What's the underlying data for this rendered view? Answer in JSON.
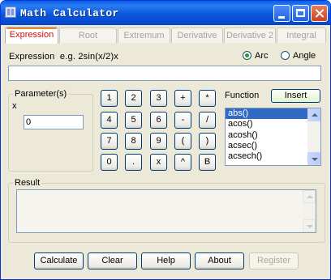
{
  "window": {
    "title": "Math Calculator"
  },
  "tabs": [
    {
      "label": "Expression",
      "active": true
    },
    {
      "label": "Root",
      "active": false
    },
    {
      "label": "Extremum",
      "active": false
    },
    {
      "label": "Derivative",
      "active": false
    },
    {
      "label": "Derivative 2",
      "active": false
    },
    {
      "label": "Integral",
      "active": false
    }
  ],
  "expression": {
    "label": "Expression  e.g. 2sin(x/2)x",
    "value": ""
  },
  "angle_mode": {
    "arc_label": "Arc",
    "angle_label": "Angle",
    "selected": "Arc"
  },
  "parameters": {
    "group_label": "Parameter(s)",
    "var_label": "x",
    "value": "0"
  },
  "keypad": [
    [
      "1",
      "2",
      "3",
      "+",
      "*"
    ],
    [
      "4",
      "5",
      "6",
      "-",
      "/"
    ],
    [
      "7",
      "8",
      "9",
      "(",
      ")"
    ],
    [
      "0",
      ".",
      "x",
      "^",
      "B"
    ]
  ],
  "function": {
    "label": "Function",
    "insert_label": "Insert",
    "items": [
      "abs()",
      "acos()",
      "acosh()",
      "acsec()",
      "acsech()"
    ],
    "selected": "abs()"
  },
  "result": {
    "group_label": "Result",
    "value": ""
  },
  "buttons": {
    "calculate": "Calculate",
    "clear": "Clear",
    "help": "Help",
    "about": "About",
    "register": "Register"
  },
  "colors": {
    "titlebar": "#0a5fe9",
    "active_tab_text": "#cc1010",
    "selection": "#316ac5",
    "radio_dot": "#21a121"
  }
}
